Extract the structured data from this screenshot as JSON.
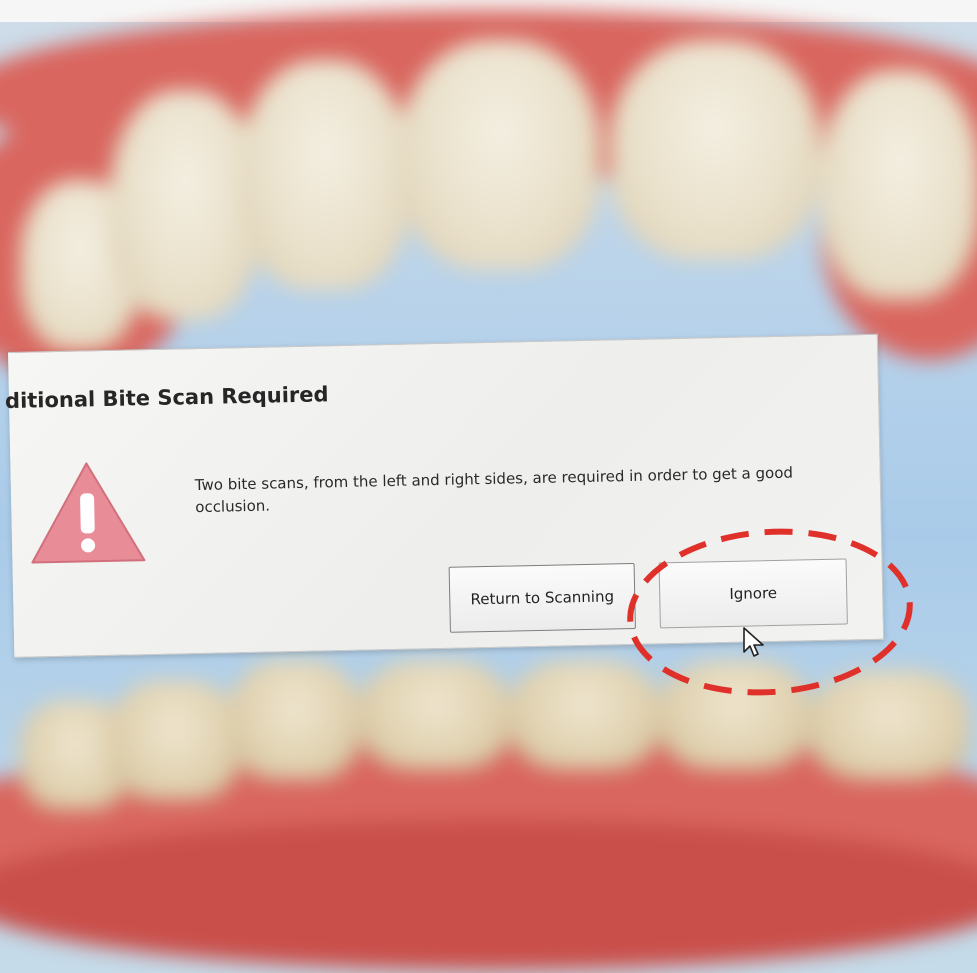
{
  "dialog": {
    "title": "ditional Bite Scan Required",
    "message": "Two bite scans, from the left and right sides, are required in order to get a good occlusion.",
    "icon": "warning-icon",
    "buttons": {
      "return_label": "Return to Scanning",
      "ignore_label": "Ignore"
    }
  },
  "colors": {
    "warning_fill": "#e88d98",
    "annotation_red": "#e0302a",
    "gum": "#d9665f",
    "background_blue": "#b9d3ea"
  },
  "annotation": {
    "shape": "dashed-ellipse",
    "target": "ignore-button"
  }
}
